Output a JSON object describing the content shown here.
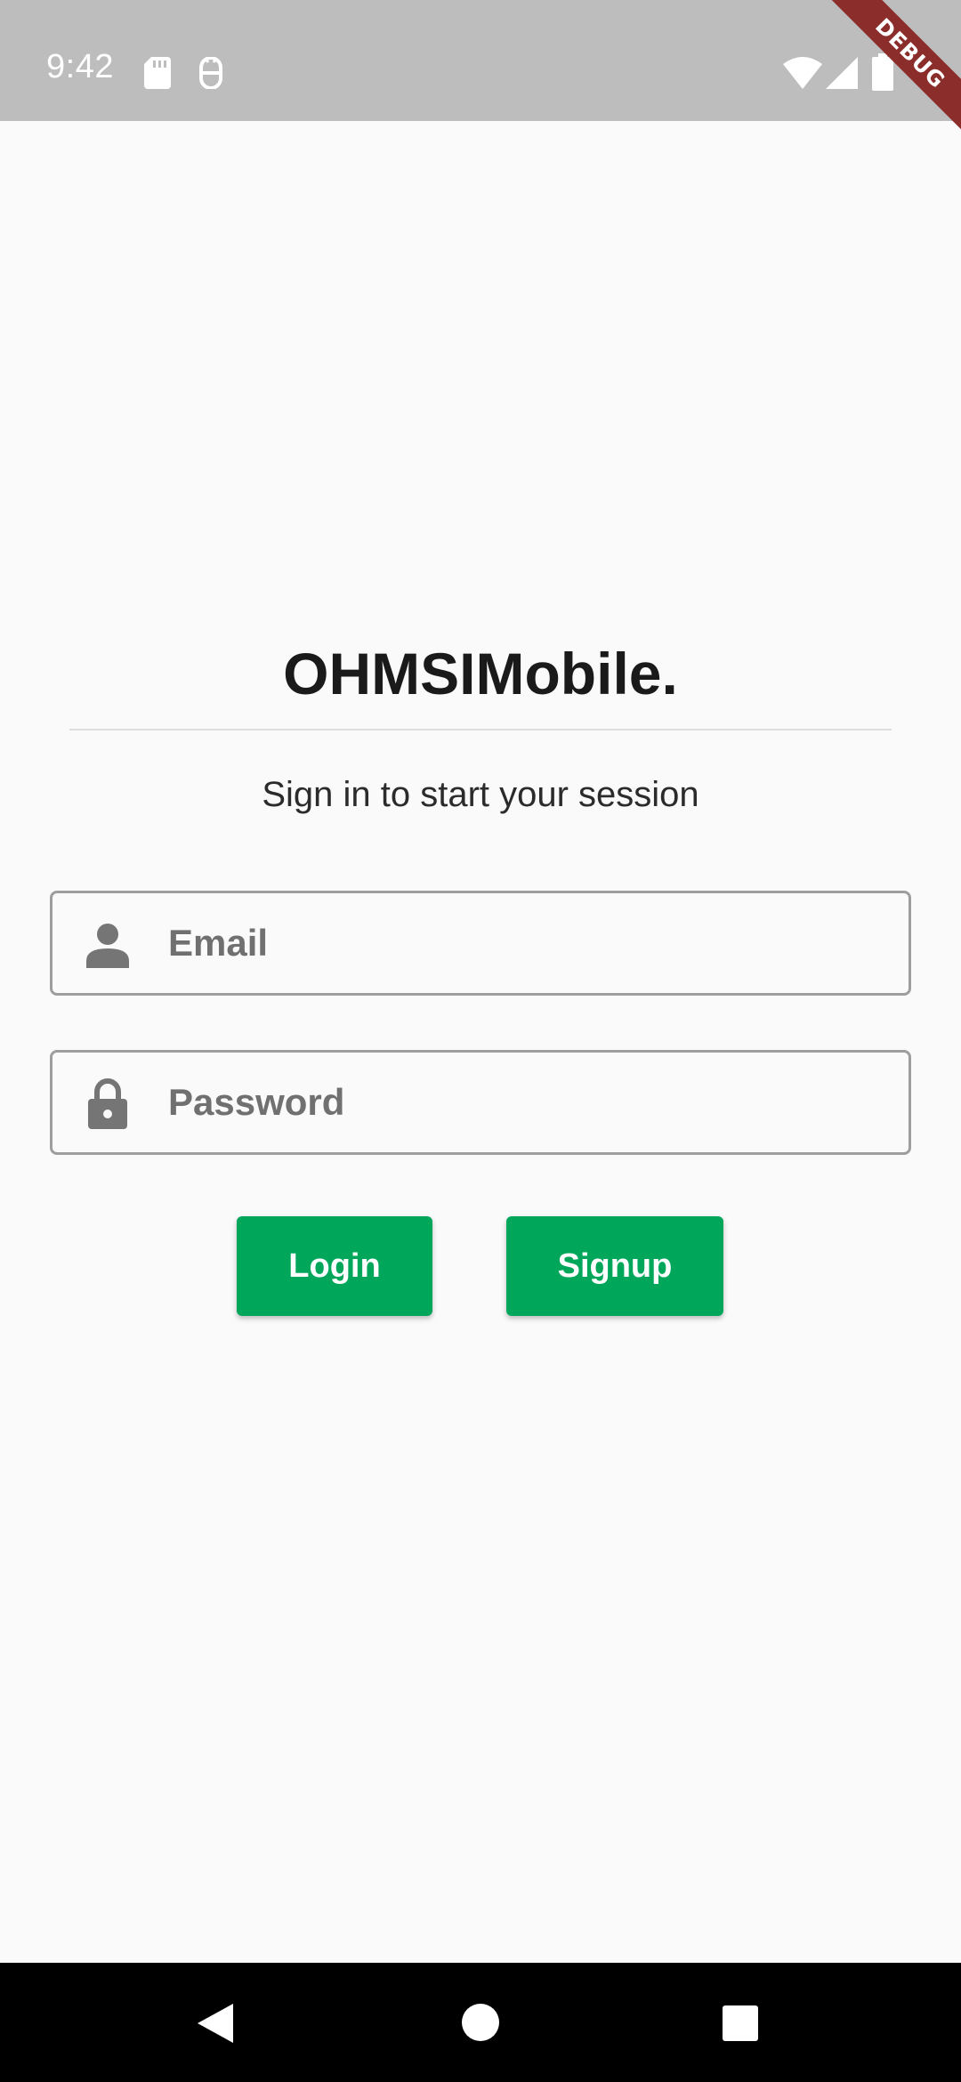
{
  "status_bar": {
    "time": "9:42",
    "icons": [
      "sd-card-icon",
      "android-debug-icon",
      "wifi-icon",
      "cell-signal-icon",
      "battery-icon"
    ],
    "debug_banner": "DEBUG",
    "background": "#bdbdbd"
  },
  "login": {
    "brand": "OHMSIMobile.",
    "subtitle": "Sign in to start your session",
    "email": {
      "placeholder": "Email",
      "value": ""
    },
    "password": {
      "placeholder": "Password",
      "value": ""
    },
    "login_label": "Login",
    "signup_label": "Signup",
    "accent_color": "#00a65a"
  },
  "nav_bar": {
    "buttons": [
      "back-icon",
      "home-icon",
      "recents-icon"
    ]
  }
}
